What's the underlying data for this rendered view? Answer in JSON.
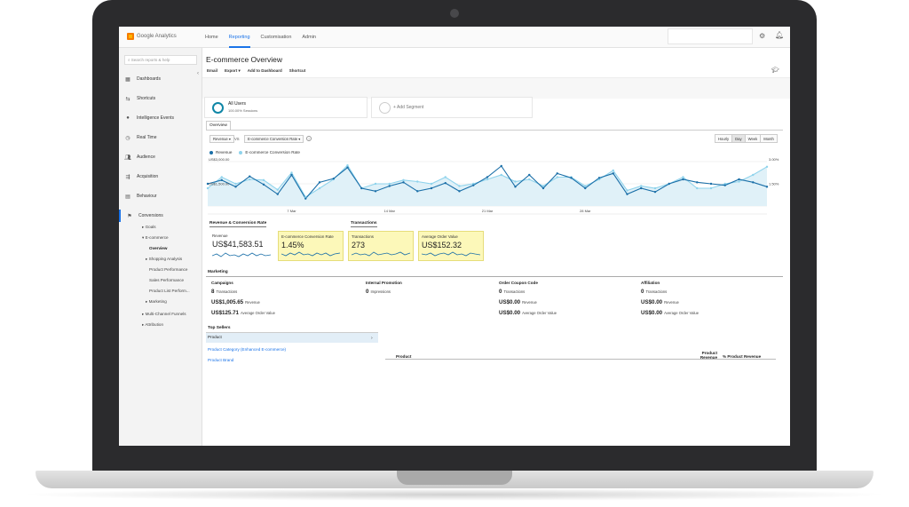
{
  "app": {
    "logo_text": "Google Analytics"
  },
  "topnav": {
    "items": [
      "Home",
      "Reporting",
      "Customisation",
      "Admin"
    ],
    "active": "Reporting"
  },
  "sidebar": {
    "search_placeholder": "Search reports & help",
    "items": [
      {
        "label": "Dashboards",
        "icon": "grid-icon"
      },
      {
        "label": "Shortcuts",
        "icon": "arrows-icon"
      },
      {
        "label": "Intelligence Events",
        "icon": "lightbulb-icon"
      },
      {
        "label": "Real Time",
        "icon": "clock-icon"
      },
      {
        "label": "Audience",
        "icon": "people-icon"
      },
      {
        "label": "Acquisition",
        "icon": "acquisition-icon"
      },
      {
        "label": "Behaviour",
        "icon": "behaviour-icon"
      },
      {
        "label": "Conversions",
        "icon": "flag-icon"
      }
    ],
    "sub": {
      "goals": "▸ Goals",
      "ecommerce": "▾ E-commerce",
      "overview": "Overview",
      "shopping_analysis": "▸ Shopping Analysis",
      "product_performance": "Product Performance",
      "sales_performance": "Sales Performance",
      "product_list": "Product List Perform...",
      "marketing": "▸ Marketing",
      "multi_channel": "▸ Multi-Channel Funnels",
      "attribution": "▸ Attribution"
    }
  },
  "main": {
    "title": "E-commerce Overview",
    "toolbar": [
      "Email",
      "Export ▾",
      "Add to Dashboard",
      "Shortcut"
    ],
    "segments": [
      {
        "name": "All Users",
        "sub": "100.00% Sessions"
      },
      {
        "name": "+ Add Segment"
      }
    ],
    "tab": "Overview",
    "metric_primary": "Revenue ▾",
    "vs": "VS",
    "metric_secondary": "E-commerce Conversion Rate ▾",
    "granularity": [
      "Hourly",
      "Day",
      "Week",
      "Month"
    ],
    "granularity_selected": "Day",
    "legend": [
      {
        "name": "Revenue",
        "color": "#1a6fa8"
      },
      {
        "name": "E-commerce Conversion Rate",
        "color": "#8fd3ec"
      }
    ]
  },
  "chart_data": {
    "type": "line",
    "y_left_ticks": [
      "US$3,000.00",
      "US$1,500.00"
    ],
    "y_right_ticks": [
      "3.00%",
      "1.50%"
    ],
    "x_ticks": [
      "7 Mar",
      "14 Mar",
      "21 Mar",
      "28 Mar"
    ],
    "series": [
      {
        "name": "Revenue",
        "values": [
          1500,
          1750,
          1300,
          2000,
          1450,
          800,
          2100,
          500,
          1600,
          1850,
          2600,
          1200,
          1000,
          1350,
          1600,
          1000,
          1200,
          1550,
          1000,
          1400,
          1950,
          2700,
          1300,
          2100,
          1200,
          2200,
          1900,
          1200,
          1900,
          2200,
          800,
          1200,
          950,
          1500,
          1800,
          1600,
          1500,
          1400,
          1800,
          1600,
          1300
        ],
        "color": "#1a6fa8"
      },
      {
        "name": "E-commerce Conversion Rate",
        "values": [
          1.2,
          1.95,
          1.5,
          1.8,
          1.75,
          1.1,
          2.25,
          0.6,
          1.2,
          1.8,
          2.75,
          1.2,
          1.5,
          1.5,
          1.75,
          1.65,
          1.5,
          1.95,
          1.35,
          1.5,
          1.8,
          2.1,
          1.65,
          1.8,
          1.35,
          1.95,
          1.95,
          1.35,
          1.8,
          2.4,
          1.05,
          1.35,
          1.2,
          1.5,
          1.95,
          1.2,
          1.2,
          1.5,
          1.65,
          2.1,
          2.65
        ],
        "color": "#8fd3ec"
      }
    ],
    "ylim": [
      0,
      3000
    ],
    "y2lim": [
      0,
      3.0
    ]
  },
  "scorecards": {
    "titles": [
      "Revenue & Conversion Rate",
      "Transactions"
    ],
    "cards": [
      {
        "label": "Revenue",
        "value": "US$41,583.51",
        "highlight": false
      },
      {
        "label": "E-commerce Conversion Rate",
        "value": "1.45%",
        "highlight": true
      },
      {
        "label": "Transactions",
        "value": "273",
        "highlight": true
      },
      {
        "label": "Average Order Value",
        "value": "US$152.32",
        "highlight": true
      }
    ]
  },
  "marketing": {
    "title": "Marketing",
    "columns": [
      {
        "header": "Campaigns",
        "rows": [
          {
            "v": "8",
            "l": "Transactions"
          },
          {
            "v": "US$1,005.65",
            "l": "Revenue"
          },
          {
            "v": "US$125.71",
            "l": "Average Order Value"
          }
        ]
      },
      {
        "header": "Internal Promotion",
        "rows": [
          {
            "v": "0",
            "l": "Impressions"
          }
        ]
      },
      {
        "header": "Order Coupon Code",
        "rows": [
          {
            "v": "0",
            "l": "Transactions"
          },
          {
            "v": "US$0.00",
            "l": "Revenue"
          },
          {
            "v": "US$0.00",
            "l": "Average Order Value"
          }
        ]
      },
      {
        "header": "Affiliation",
        "rows": [
          {
            "v": "0",
            "l": "Transactions"
          },
          {
            "v": "US$0.00",
            "l": "Revenue"
          },
          {
            "v": "US$0.00",
            "l": "Average Order Value"
          }
        ]
      }
    ]
  },
  "top_sellers": {
    "title": "Top Sellers",
    "items": [
      "Product",
      "Product Category (Enhanced E-commerce)",
      "Product Brand"
    ],
    "table_headers": [
      "Product",
      "Product Revenue",
      "% Product Revenue"
    ]
  },
  "colors": {
    "accent": "#1a73e8",
    "highlight": "#fcf8b9",
    "revenue": "#1a6fa8",
    "rate": "#8fd3ec"
  }
}
